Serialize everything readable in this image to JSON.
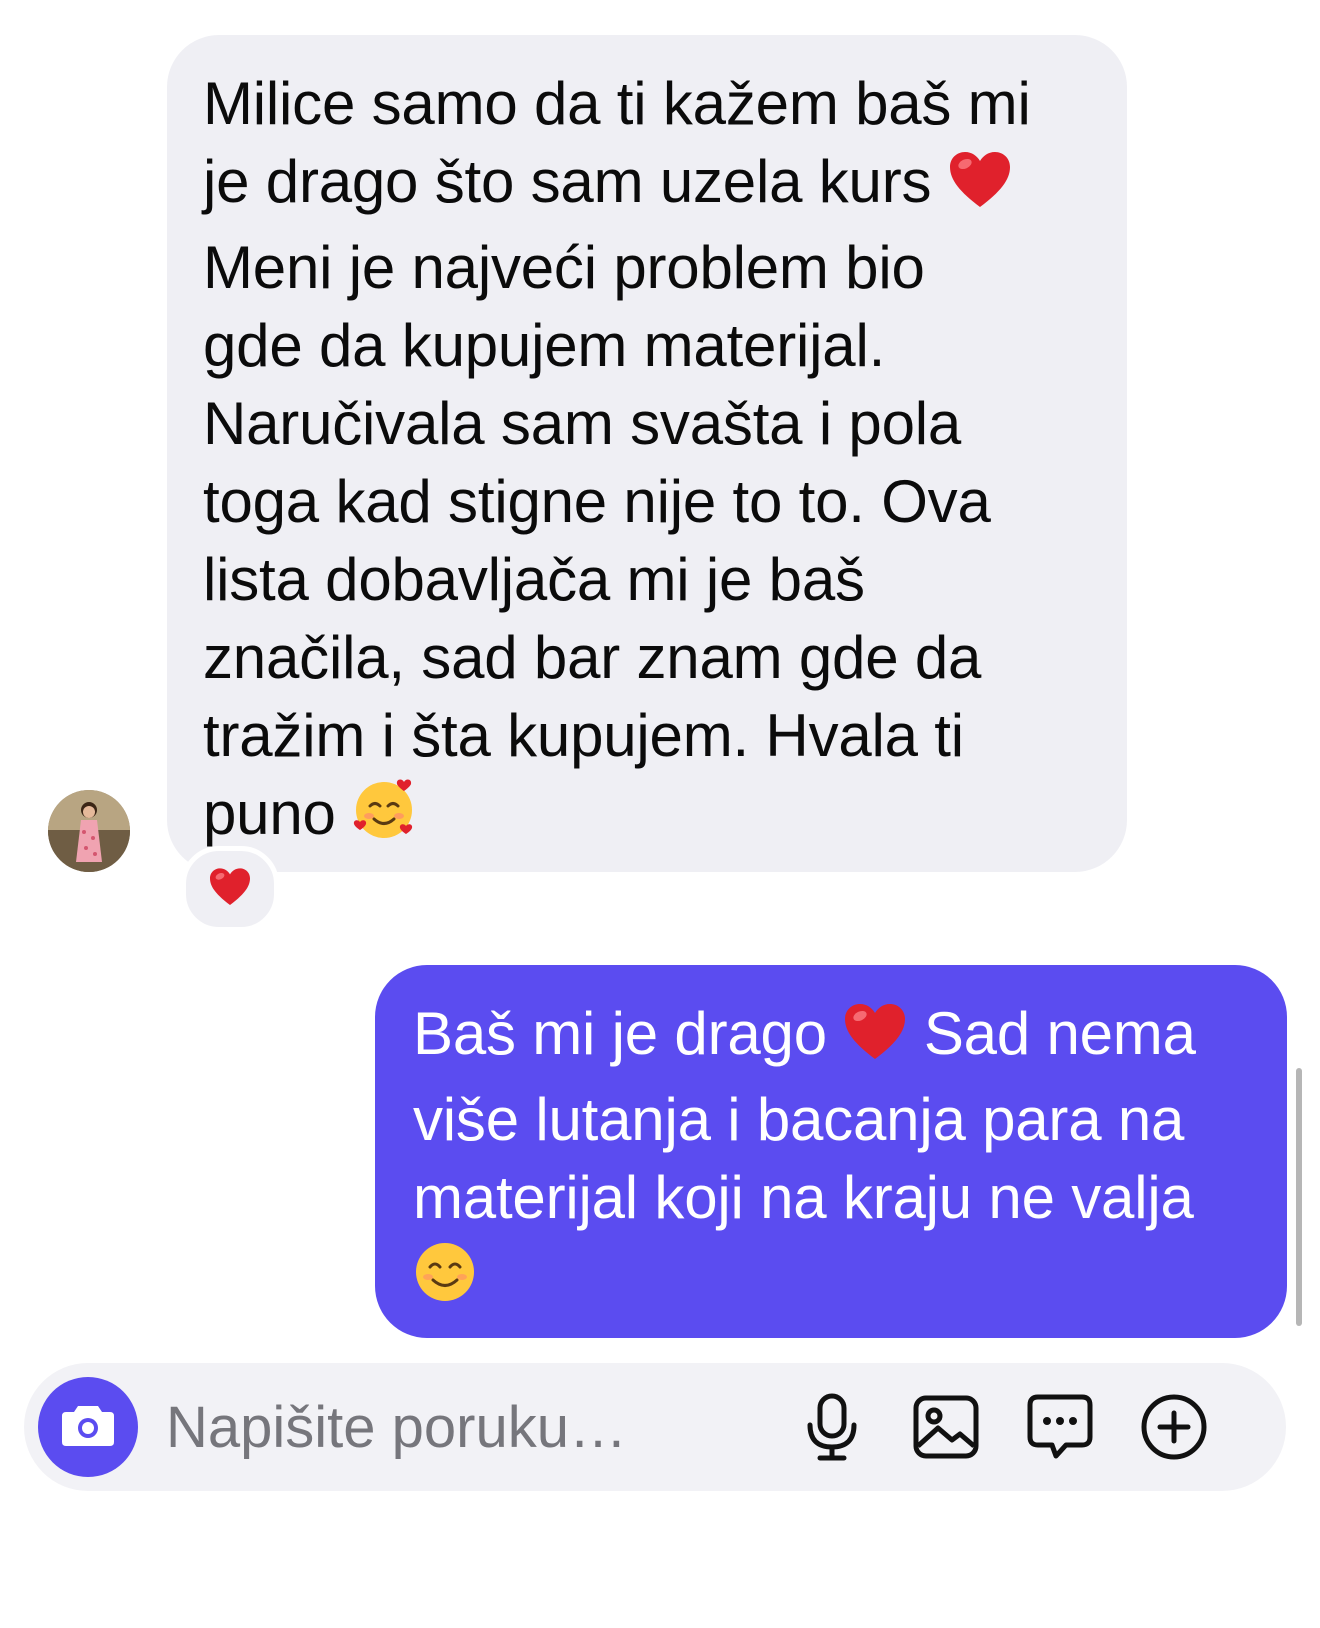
{
  "conversation": {
    "incoming": {
      "text_lines": [
        "Milice samo da ti kažem baš mi",
        "je drago što sam uzela kurs",
        "Meni je najveći problem bio",
        "gde da kupujem materijal.",
        "Naručivala sam svašta i pola",
        "toga kad stigne nije to to. Ova",
        "lista dobavljača mi je baš",
        "značila, sad bar znam gde da",
        "tražim i šta kupujem. Hvala ti",
        "puno"
      ],
      "inline_emoji": [
        {
          "after_line": 1,
          "icon": "red-heart-icon"
        },
        {
          "after_line": 9,
          "icon": "smiling-face-with-hearts-icon"
        }
      ],
      "reaction": "red-heart-icon"
    },
    "outgoing": {
      "text_lines": [
        "Baš mi je drago",
        "Sad nema",
        "više lutanja i bacanja para na",
        "materijal koji na kraju ne valja"
      ],
      "inline_emoji": [
        {
          "between": "line 0 and line 1",
          "icon": "red-heart-icon"
        },
        {
          "after_line": 3,
          "icon": "smiling-face-icon"
        }
      ]
    }
  },
  "composer": {
    "placeholder": "Napišite poruku…",
    "value": "",
    "icons": [
      "camera-icon",
      "microphone-icon",
      "image-icon",
      "message-dots-icon",
      "plus-circle-icon"
    ]
  },
  "colors": {
    "incoming_bubble": "#efeff4",
    "outgoing_bubble": "#5b4cf0",
    "accent": "#5b4cf0",
    "text_dark": "#0b0b0b",
    "placeholder": "#76767c"
  }
}
